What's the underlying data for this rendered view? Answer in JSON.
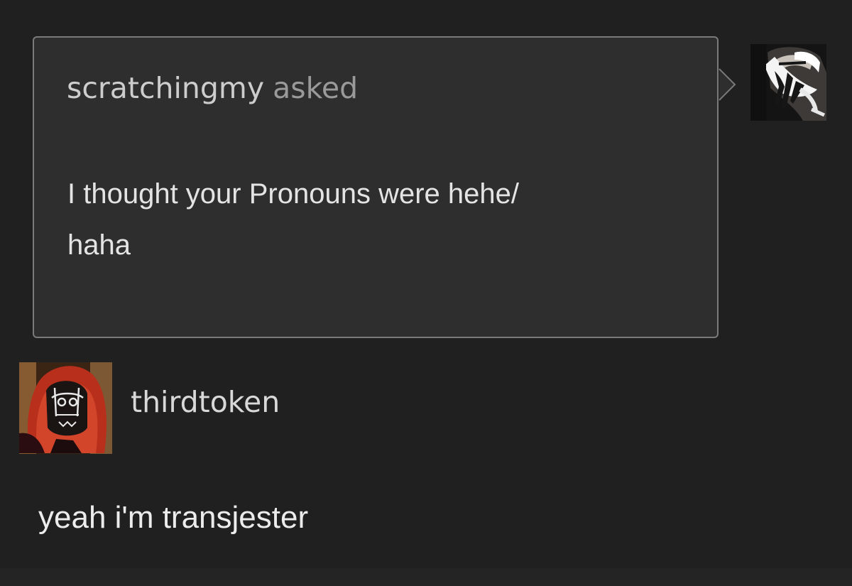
{
  "ask": {
    "asker_username": "scratchingmy",
    "asked_label": "asked",
    "question_line1": "I thought your Pronouns were hehe/",
    "question_line2": "haha",
    "asker_avatar_icon": "masked-face-avatar-icon"
  },
  "answer": {
    "answerer_username": "thirdtoken",
    "answer_text": "yeah i'm transjester",
    "answerer_avatar_icon": "red-haired-masked-avatar-icon"
  },
  "colors": {
    "background": "#202020",
    "ask_box_fill": "#2e2e2e",
    "ask_box_border": "#7a7a7a",
    "username_text": "#cdcdcd",
    "muted_text": "#9a9a9a",
    "body_text": "#e4e4e4"
  }
}
